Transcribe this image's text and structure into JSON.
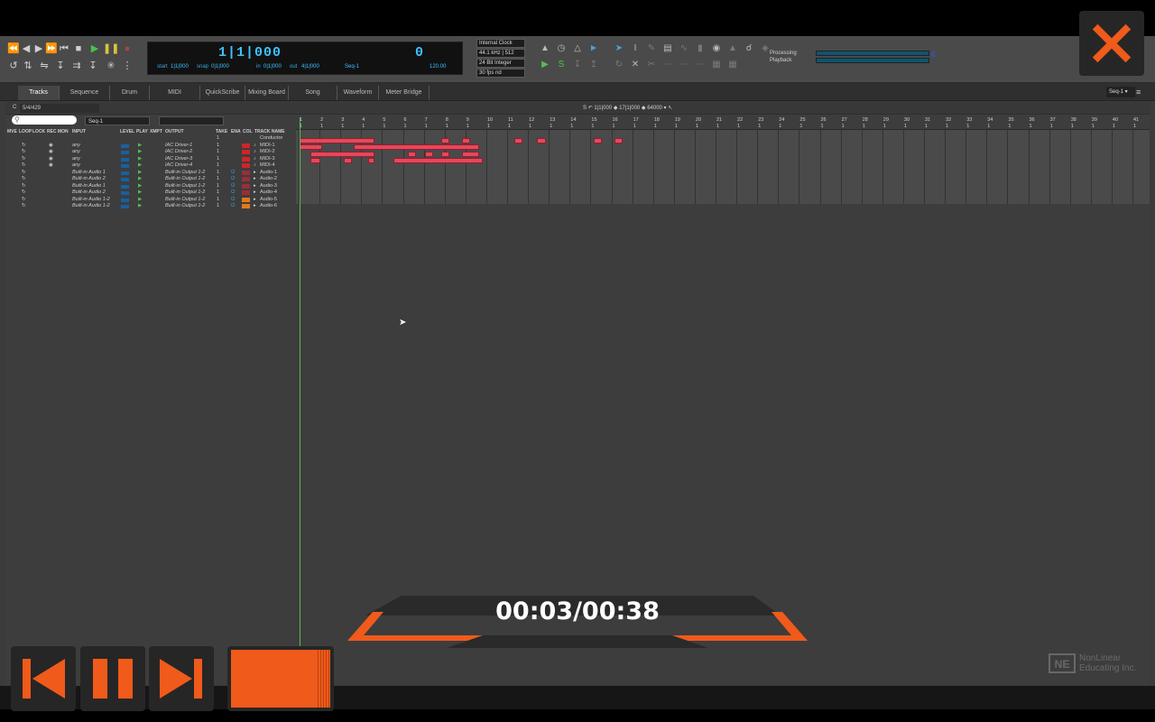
{
  "toolbar": {
    "main_counter": "1|1|000",
    "sub_counter": "0",
    "start_label": "start",
    "start_value": "1|1|000",
    "snap_label": "snap",
    "snap_value": "0|1|000",
    "in_label": "in",
    "in_value": "0|1|000",
    "out_label": "out",
    "out_value": "4|1|000",
    "seq_value": "Seq-1",
    "tempo_value": "120.00",
    "clock": [
      "Internal Clock",
      "44.1 kHz",
      "512",
      "24 Bit Integer",
      "30 fps nd"
    ],
    "processing_label": "Processing",
    "playback_label": "Playback",
    "processing_level": 1.0,
    "playback_level": 1.0
  },
  "tabs": [
    "Tracks",
    "Sequence",
    "Drum",
    "MIDI",
    "QuickScribe",
    "Mixing Board",
    "Song",
    "Waveform",
    "Meter Bridge"
  ],
  "active_tab": "Tracks",
  "seq_selector": "Seq-1",
  "subbar": {
    "pos_label": "C",
    "pos_value": "5/4/429",
    "center": "S  ↶  1|1|000  ◆  17|1|000  ◆  64000  ▾  ↖"
  },
  "filters": {
    "search_placeholder": "",
    "seq_filter": "Seq-1"
  },
  "track_columns": [
    "MVE",
    "LOOP",
    "LOCK",
    "REC",
    "MON",
    "INPUT",
    "LEVEL",
    "PLAY",
    "XMPT",
    "OUTPUT",
    "TAKE",
    "ENA",
    "COL",
    "TRACK NAME"
  ],
  "tracks": [
    {
      "input": "",
      "output": "",
      "take": "1",
      "color": "",
      "name": "Conductor",
      "italic": false,
      "type": "conductor"
    },
    {
      "input": "any",
      "output": "IAC Driver-1",
      "take": "1",
      "color": "#d02525",
      "name": "MIDI-1",
      "italic": true,
      "type": "midi"
    },
    {
      "input": "any",
      "output": "IAC Driver-2",
      "take": "1",
      "color": "#d02525",
      "name": "MIDI-2",
      "italic": true,
      "type": "midi"
    },
    {
      "input": "any",
      "output": "IAC Driver-3",
      "take": "1",
      "color": "#d02525",
      "name": "MIDI-3",
      "italic": true,
      "type": "midi"
    },
    {
      "input": "any",
      "output": "IAC Driver-4",
      "take": "1",
      "color": "#d02525",
      "name": "MIDI-4",
      "italic": true,
      "type": "midi"
    },
    {
      "input": "Built-in Audio 1",
      "output": "Built-in Output 1-2",
      "take": "1",
      "color": "#9a2d3a",
      "name": "Audio-1",
      "italic": true,
      "type": "audio"
    },
    {
      "input": "Built-in Audio 2",
      "output": "Built-in Output 1-2",
      "take": "1",
      "color": "#9a2d3a",
      "name": "Audio-2",
      "italic": true,
      "type": "audio"
    },
    {
      "input": "Built-in Audio 1",
      "output": "Built-in Output 1-2",
      "take": "1",
      "color": "#9a2d3a",
      "name": "Audio-3",
      "italic": true,
      "type": "audio"
    },
    {
      "input": "Built-in Audio 2",
      "output": "Built-in Output 1-2",
      "take": "1",
      "color": "#9a2d3a",
      "name": "Audio-4",
      "italic": true,
      "type": "audio"
    },
    {
      "input": "Built-in Audio 1-2",
      "output": "Built-in Output 1-2",
      "take": "1",
      "color": "#e07a1a",
      "name": "Audio-5",
      "italic": true,
      "type": "audio"
    },
    {
      "input": "Built-in Audio 1-2",
      "output": "Built-in Output 1-2",
      "take": "1",
      "color": "#e07a1a",
      "name": "Audio-6",
      "italic": true,
      "type": "audio"
    }
  ],
  "ruler_bars": [
    "1",
    "2",
    "3",
    "4",
    "5",
    "6",
    "7",
    "8",
    "9",
    "10",
    "11",
    "12",
    "13",
    "14",
    "15",
    "16",
    "17",
    "18",
    "19",
    "20",
    "21",
    "22",
    "23",
    "24",
    "25",
    "26",
    "27",
    "28",
    "29",
    "30",
    "31",
    "32",
    "33",
    "34",
    "35",
    "36",
    "37",
    "38",
    "39",
    "40",
    "41"
  ],
  "clips": [
    {
      "track": 1,
      "start": 1.0,
      "end": 4.6
    },
    {
      "track": 1,
      "start": 7.8,
      "end": 8.2
    },
    {
      "track": 1,
      "start": 8.8,
      "end": 9.2
    },
    {
      "track": 1,
      "start": 11.3,
      "end": 11.7
    },
    {
      "track": 1,
      "start": 12.4,
      "end": 12.8
    },
    {
      "track": 1,
      "start": 15.1,
      "end": 15.5
    },
    {
      "track": 1,
      "start": 16.1,
      "end": 16.5
    },
    {
      "track": 2,
      "start": 1.0,
      "end": 2.1
    },
    {
      "track": 2,
      "start": 3.6,
      "end": 9.6
    },
    {
      "track": 3,
      "start": 1.5,
      "end": 4.6
    },
    {
      "track": 3,
      "start": 6.2,
      "end": 6.6
    },
    {
      "track": 3,
      "start": 7.0,
      "end": 7.4
    },
    {
      "track": 3,
      "start": 7.8,
      "end": 8.2
    },
    {
      "track": 3,
      "start": 8.8,
      "end": 9.6
    },
    {
      "track": 4,
      "start": 1.5,
      "end": 2.0
    },
    {
      "track": 4,
      "start": 3.1,
      "end": 3.5
    },
    {
      "track": 4,
      "start": 4.3,
      "end": 4.6
    },
    {
      "track": 4,
      "start": 5.5,
      "end": 9.8
    }
  ],
  "playhead_bar": 1.0,
  "overlay": {
    "time": "00:03/00:38",
    "watermark_logo": "NE",
    "watermark_text_1": "NonLinear",
    "watermark_text_2": "Educating Inc.",
    "progress_fraction": 0.08
  },
  "colors": {
    "accent": "#f05a1a",
    "clip": "#e8475a",
    "counter": "#3fc1ff",
    "playhead": "#4fc24f"
  }
}
